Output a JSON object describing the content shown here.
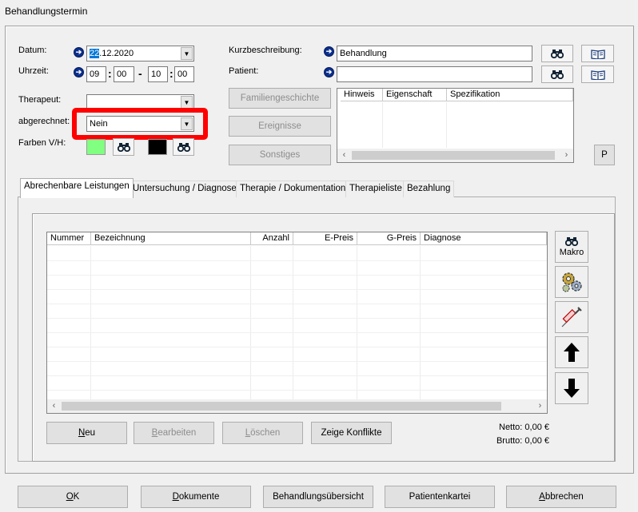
{
  "window": {
    "title": "Behandlungstermin"
  },
  "form": {
    "datum_label": "Datum:",
    "datum_day": "22",
    "datum_rest": ".12.2020",
    "uhrzeit_label": "Uhrzeit:",
    "time_from_h": "09",
    "time_from_m": "00",
    "time_sep": "-",
    "time_to_h": "10",
    "time_to_m": "00",
    "therapeut_label": "Therapeut:",
    "therapeut_value": "",
    "abgerechnet_label": "abgerechnet:",
    "abgerechnet_value": "Nein",
    "farben_label": "Farben V/H:",
    "farbe_v": "#80ff80",
    "farbe_h": "#000000",
    "kurz_label": "Kurzbeschreibung:",
    "kurz_value": "Behandlung",
    "patient_label": "Patient:",
    "patient_value": ""
  },
  "middle_buttons": {
    "familie": "Familiengeschichte",
    "ereignisse": "Ereignisse",
    "sonstiges": "Sonstiges"
  },
  "hinweis_table": {
    "columns": [
      "Hinweis",
      "Eigenschaft",
      "Spezifikation"
    ]
  },
  "p_button": "P",
  "tabs": [
    "Abrechenbare Leistungen",
    "Untersuchung / Diagnose",
    "Therapie / Dokumentation",
    "Therapieliste",
    "Bezahlung"
  ],
  "leistungen_table": {
    "columns": [
      "Nummer",
      "Bezeichnung",
      "Anzahl",
      "E-Preis",
      "G-Preis",
      "Diagnose"
    ]
  },
  "side_buttons": {
    "makro": "Makro"
  },
  "list_buttons": {
    "neu_u": "N",
    "neu_rest": "eu",
    "bearbeiten_u": "B",
    "bearbeiten_rest": "earbeiten",
    "loeschen_u": "L",
    "loeschen_rest": "öschen",
    "konflikte": "Zeige Konflikte"
  },
  "totals": {
    "netto": "Netto: 0,00 €",
    "brutto": "Brutto: 0,00 €"
  },
  "footer": {
    "ok_u": "O",
    "ok_rest": "K",
    "dokumente_u": "D",
    "dokumente_rest": "okumente",
    "uebersicht": "Behandlungsübersicht",
    "kartei": "Patientenkartei",
    "abbrechen_u": "A",
    "abbrechen_rest": "bbrechen"
  }
}
